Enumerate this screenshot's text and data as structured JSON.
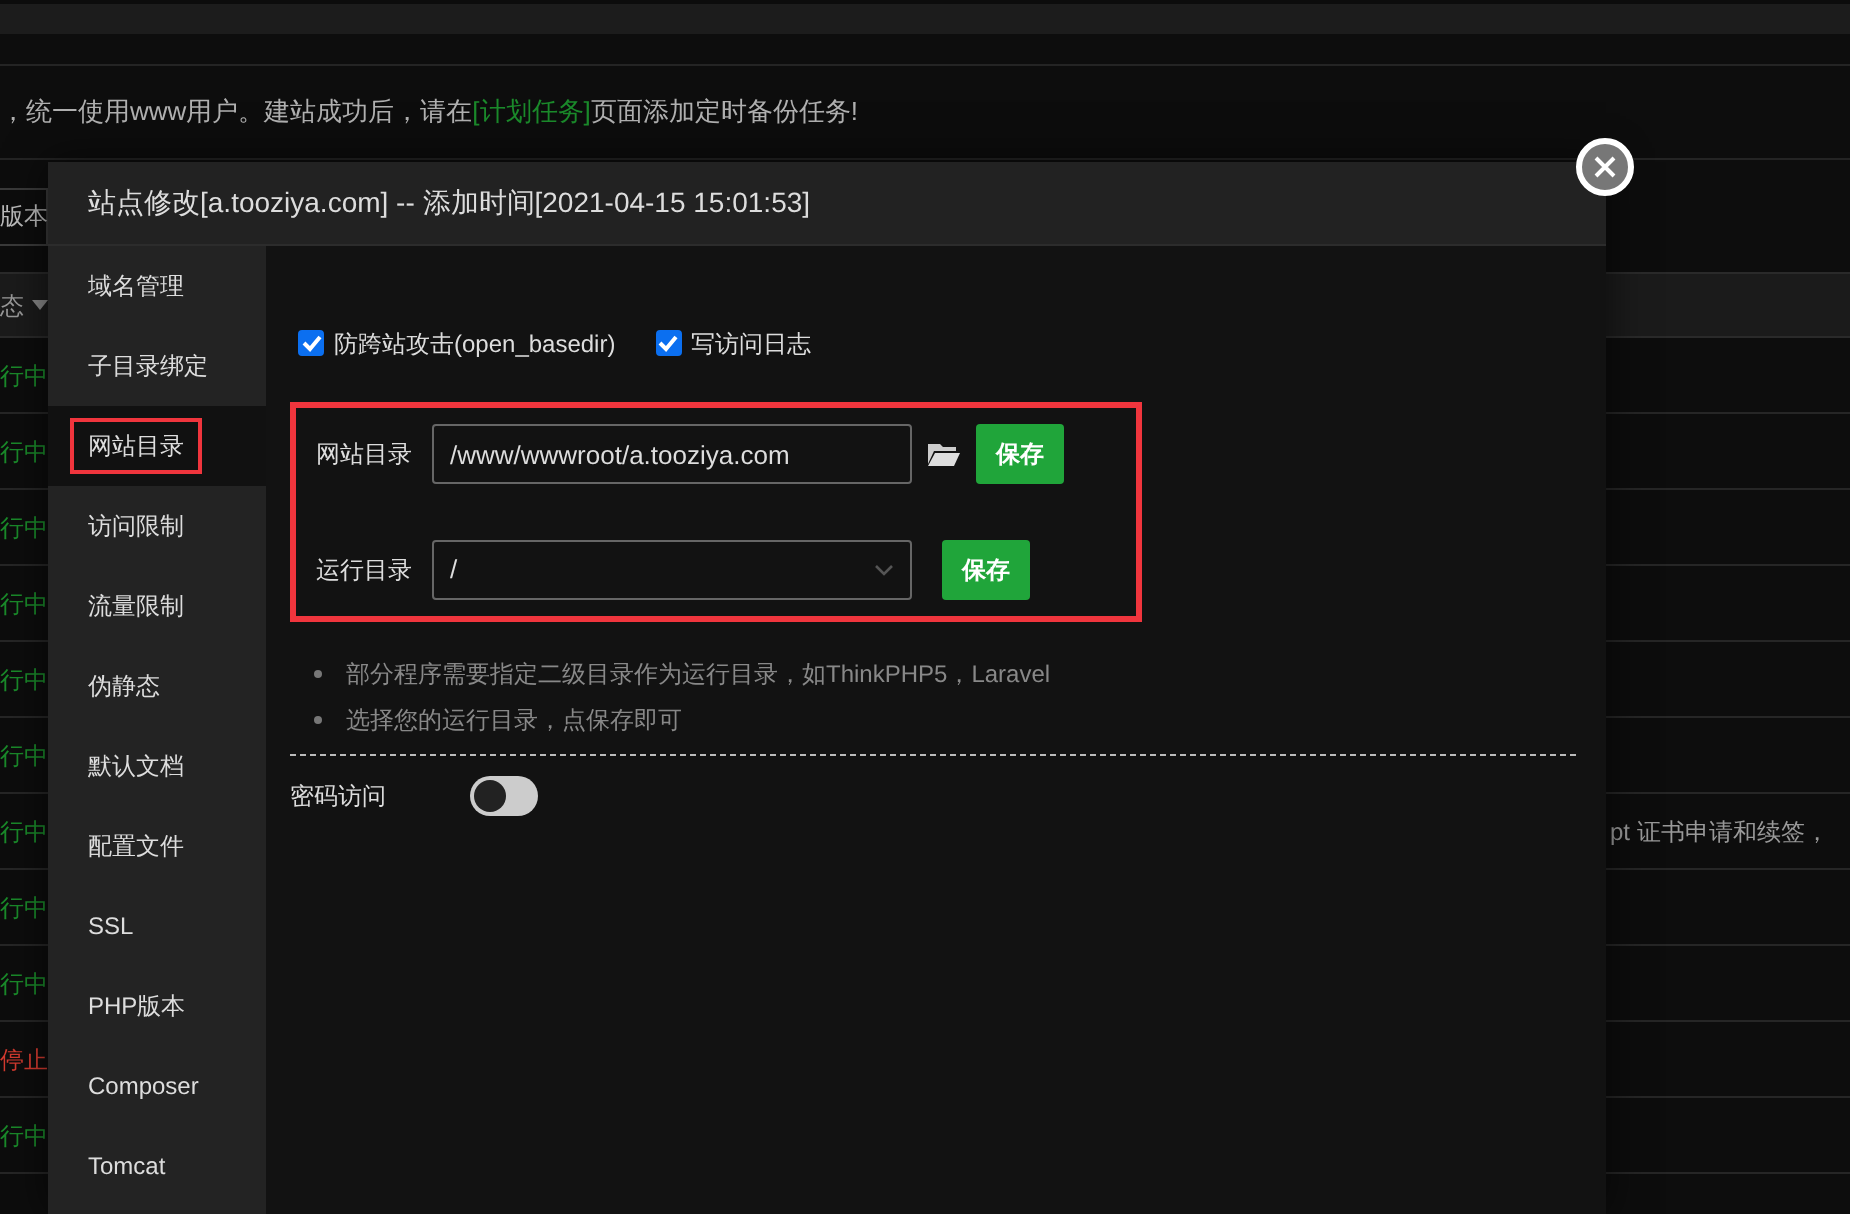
{
  "background": {
    "notice": {
      "text": "，统一使用www用户。建站成功后，请在",
      "link": "[计划任务]",
      "after": "页面添加定时备份任务!"
    },
    "version_button": "版本",
    "status_header": "态",
    "rows": [
      {
        "kind": "running",
        "status": "行中"
      },
      {
        "kind": "running",
        "status": "行中"
      },
      {
        "kind": "running",
        "status": "行中"
      },
      {
        "kind": "running",
        "status": "行中"
      },
      {
        "kind": "running",
        "status": "行中"
      },
      {
        "kind": "running",
        "status": "行中"
      },
      {
        "kind": "running",
        "status": "行中",
        "note": "pt 证书申请和续签，"
      },
      {
        "kind": "running",
        "status": "行中"
      },
      {
        "kind": "running",
        "status": "行中"
      },
      {
        "kind": "stopped",
        "status": "停止"
      },
      {
        "kind": "running",
        "status": "行中"
      }
    ]
  },
  "dialog": {
    "title": "站点修改[a.tooziya.com] -- 添加时间[2021-04-15 15:01:53]",
    "nav": [
      {
        "label": "域名管理",
        "selected": false,
        "highlighted": false
      },
      {
        "label": "子目录绑定",
        "selected": false,
        "highlighted": false
      },
      {
        "label": "网站目录",
        "selected": true,
        "highlighted": true
      },
      {
        "label": "访问限制",
        "selected": false,
        "highlighted": false
      },
      {
        "label": "流量限制",
        "selected": false,
        "highlighted": false
      },
      {
        "label": "伪静态",
        "selected": false,
        "highlighted": false
      },
      {
        "label": "默认文档",
        "selected": false,
        "highlighted": false
      },
      {
        "label": "配置文件",
        "selected": false,
        "highlighted": false
      },
      {
        "label": "SSL",
        "selected": false,
        "highlighted": false
      },
      {
        "label": "PHP版本",
        "selected": false,
        "highlighted": false
      },
      {
        "label": "Composer",
        "selected": false,
        "highlighted": false
      },
      {
        "label": "Tomcat",
        "selected": false,
        "highlighted": false
      }
    ],
    "options": [
      {
        "label": "防跨站攻击(open_basedir)",
        "checked": true
      },
      {
        "label": "写访问日志",
        "checked": true
      }
    ],
    "section_highlighted": true,
    "fields": [
      {
        "kind": "text",
        "label": "网站目录",
        "value": "/www/wwwroot/a.tooziya.com",
        "button": "保存"
      },
      {
        "kind": "select",
        "label": "运行目录",
        "value": "/",
        "button": "保存"
      }
    ],
    "notes": [
      "部分程序需要指定二级目录作为运行目录，如ThinkPHP5，Laravel",
      "选择您的运行目录，点保存即可"
    ],
    "password_access": {
      "label": "密码访问",
      "on": false
    }
  }
}
